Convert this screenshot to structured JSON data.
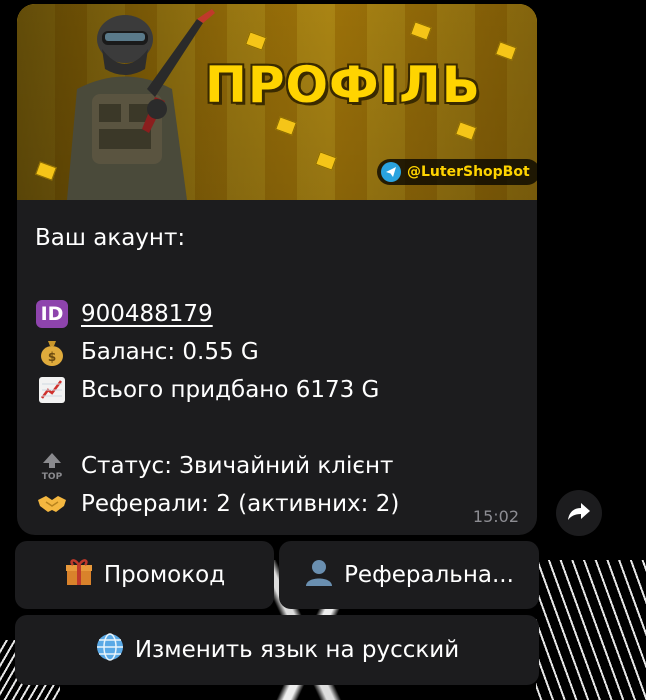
{
  "banner": {
    "title": "ПРОФІЛЬ",
    "handle": "@LuterShopBot",
    "accent": "#ffd400"
  },
  "message": {
    "header": "Ваш акаунт:",
    "id_badge": "ID",
    "user_id": "900488179",
    "balance": "Баланс: 0.55 G",
    "total_purchased": "Всього придбано 6173 G",
    "status_badge": "TOP",
    "status": "Статус: Звичайний клієнт",
    "referrals": "Реферали: 2 (активних: 2)",
    "time": "15:02"
  },
  "keyboard": {
    "promo": "Промокод",
    "referral": "Реферальна...",
    "language": "Изменить язык на русский"
  },
  "icons": {
    "id": "id-badge-icon",
    "money_bag": "money-bag-icon",
    "chart": "chart-up-icon",
    "top": "top-arrow-icon",
    "handshake": "handshake-icon",
    "gift": "gift-icon",
    "user": "user-silhouette-icon",
    "globe": "globe-icon",
    "share": "share-arrow-icon"
  }
}
